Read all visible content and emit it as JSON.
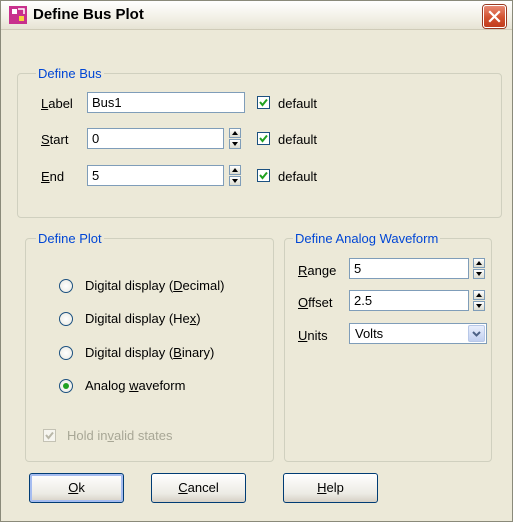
{
  "window": {
    "title": "Define Bus Plot"
  },
  "define_bus": {
    "legend": "Define Bus",
    "label": {
      "mnemonic": "L",
      "rest": "abel",
      "value": "Bus1",
      "default_label": "default",
      "default_checked": true
    },
    "start": {
      "mnemonic": "S",
      "rest": "tart",
      "value": "0",
      "default_label": "default",
      "default_checked": true
    },
    "end": {
      "mnemonic": "E",
      "rest": "nd",
      "value": "5",
      "default_label": "default",
      "default_checked": true
    }
  },
  "define_plot": {
    "legend": "Define Plot",
    "options": [
      {
        "pre": "Digital display (",
        "mnemonic": "D",
        "post": "ecimal)",
        "selected": false
      },
      {
        "pre": "Digital display (He",
        "mnemonic": "x",
        "post": ")",
        "selected": false
      },
      {
        "pre": "Digital display (",
        "mnemonic": "B",
        "post": "inary)",
        "selected": false
      },
      {
        "pre": "Analog ",
        "mnemonic": "w",
        "post": "aveform",
        "selected": true
      }
    ],
    "hold_invalid": {
      "pre": "Hold in",
      "mnemonic": "v",
      "post": "alid states",
      "checked": true,
      "enabled": false
    }
  },
  "define_analog": {
    "legend": "Define Analog Waveform",
    "range": {
      "mnemonic": "R",
      "rest": "ange",
      "value": "5"
    },
    "offset": {
      "mnemonic": "O",
      "rest": "ffset",
      "value": "2.5"
    },
    "units": {
      "mnemonic": "U",
      "rest": "nits",
      "value": "Volts"
    }
  },
  "buttons": {
    "ok": {
      "mnemonic": "O",
      "rest": "k"
    },
    "cancel": {
      "mnemonic": "C",
      "rest": "ancel"
    },
    "help": {
      "mnemonic": "H",
      "rest": "elp"
    }
  },
  "colors": {
    "legend": "#0046d5",
    "checkmark": "#21a121",
    "close": "#d2512f",
    "face": "#ece9d8"
  }
}
